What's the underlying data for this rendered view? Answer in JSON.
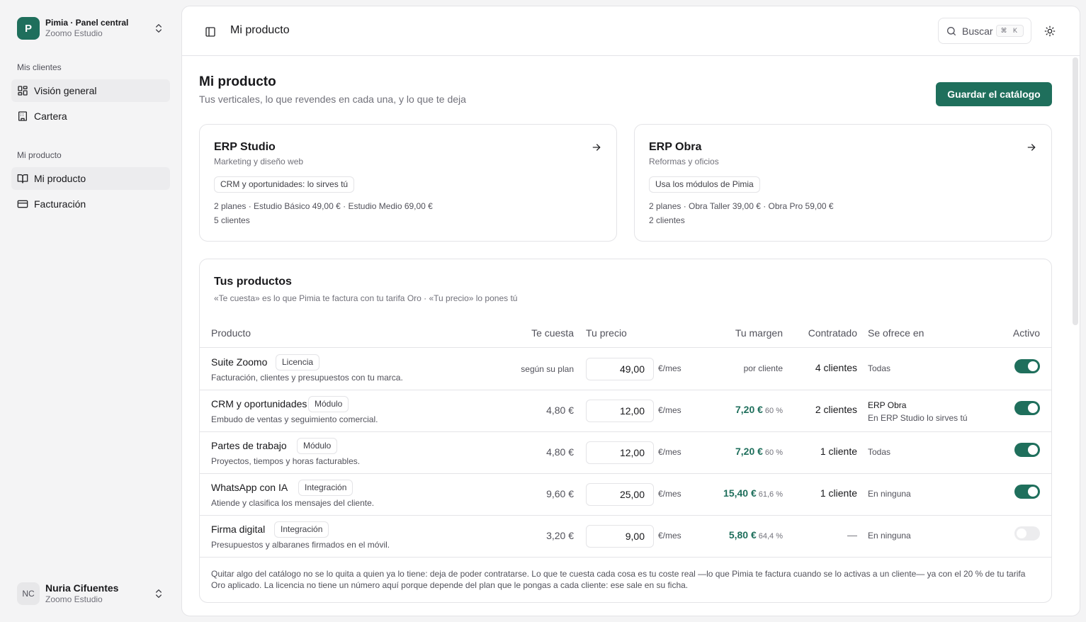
{
  "workspace": {
    "logo": "P",
    "title": "Pimia · Panel central",
    "subtitle": "Zoomo Estudio",
    "icon": "chevrons-up-down-icon"
  },
  "nav": {
    "group1_label": "Mis clientes",
    "group1": [
      {
        "label": "Visión general",
        "icon": "layout-grid-icon",
        "active": true
      },
      {
        "label": "Cartera",
        "icon": "building-icon",
        "active": false
      }
    ],
    "group2_label": "Mi producto",
    "group2": [
      {
        "label": "Mi producto",
        "icon": "book-open-icon",
        "active": true
      },
      {
        "label": "Facturación",
        "icon": "credit-card-icon",
        "active": false
      }
    ]
  },
  "user": {
    "initials": "NC",
    "name": "Nuria Cifuentes",
    "subtitle": "Zoomo Estudio"
  },
  "topbar": {
    "title": "Mi producto",
    "search_label": "Buscar",
    "search_shortcut": "⌘ K",
    "icons": [
      "panel-left-icon",
      "search-icon",
      "sun-icon"
    ]
  },
  "page": {
    "title": "Mi producto",
    "subtitle": "Tus verticales, lo que revendes en cada una, y lo que te deja",
    "save_label": "Guardar el catálogo"
  },
  "verticals": [
    {
      "title": "ERP Studio",
      "subtitle": "Marketing y diseño web",
      "badge": "CRM y oportunidades: lo sirves tú",
      "plans": "2 planes · Estudio Básico 49,00 € · Estudio Medio 69,00 €",
      "clients": "5 clientes"
    },
    {
      "title": "ERP Obra",
      "subtitle": "Reformas y oficios",
      "badge": "Usa los módulos de Pimia",
      "plans": "2 planes · Obra Taller 39,00 € · Obra Pro 59,00 €",
      "clients": "2 clientes"
    }
  ],
  "products": {
    "title": "Tus productos",
    "subtitle": "«Te cuesta» es lo que Pimia te factura con tu tarifa Oro · «Tu precio» lo pones tú",
    "columns": {
      "product": "Producto",
      "cost": "Te cuesta",
      "price": "Tu precio",
      "margin": "Tu margen",
      "contracted": "Contratado",
      "offered": "Se ofrece en",
      "active": "Activo"
    },
    "rows": [
      {
        "name": "Suite Zoomo",
        "tag": "Licencia",
        "desc": "Facturación, clientes y presupuestos con tu marca.",
        "cost": "según su plan",
        "price": "49,00",
        "unit": "€/mes",
        "margin": "",
        "margin_pct": "",
        "margin_note": "por cliente",
        "contracted": "4 clientes",
        "offered": "Todas",
        "offered_note": "",
        "active": true
      },
      {
        "name": "CRM y oportunidades",
        "tag": "Módulo",
        "desc": "Embudo de ventas y seguimiento comercial.",
        "cost": "4,80 €",
        "price": "12,00",
        "unit": "€/mes",
        "margin": "7,20 €",
        "margin_pct": "60 %",
        "margin_note": "",
        "contracted": "2 clientes",
        "offered": "ERP Obra",
        "offered_note": "En ERP Studio lo sirves tú",
        "active": true
      },
      {
        "name": "Partes de trabajo",
        "tag": "Módulo",
        "desc": "Proyectos, tiempos y horas facturables.",
        "cost": "4,80 €",
        "price": "12,00",
        "unit": "€/mes",
        "margin": "7,20 €",
        "margin_pct": "60 %",
        "margin_note": "",
        "contracted": "1 cliente",
        "offered": "Todas",
        "offered_note": "",
        "active": true
      },
      {
        "name": "WhatsApp con IA",
        "tag": "Integración",
        "desc": "Atiende y clasifica los mensajes del cliente.",
        "cost": "9,60 €",
        "price": "25,00",
        "unit": "€/mes",
        "margin": "15,40 €",
        "margin_pct": "61,6 %",
        "margin_note": "",
        "contracted": "1 cliente",
        "offered": "En ninguna",
        "offered_note": "",
        "active": true
      },
      {
        "name": "Firma digital",
        "tag": "Integración",
        "desc": "Presupuestos y albaranes firmados en el móvil.",
        "cost": "3,20 €",
        "price": "9,00",
        "unit": "€/mes",
        "margin": "5,80 €",
        "margin_pct": "64,4 %",
        "margin_note": "",
        "contracted": "—",
        "offered": "En ninguna",
        "offered_note": "",
        "active": false
      }
    ],
    "footnote": "Quitar algo del catálogo no se lo quita a quien ya lo tiene: deja de poder contratarse. Lo que te cuesta cada cosa es tu coste real —lo que Pimia te factura cuando se lo activas a un cliente— ya con el 20 % de tu tarifa Oro aplicado. La licencia no tiene un número aquí porque depende del plan que le pongas a cada cliente: ese sale en su ficha."
  },
  "colors": {
    "accent": "#1f6f5c",
    "background": "#f4f4f5",
    "border": "#e4e4e7"
  }
}
